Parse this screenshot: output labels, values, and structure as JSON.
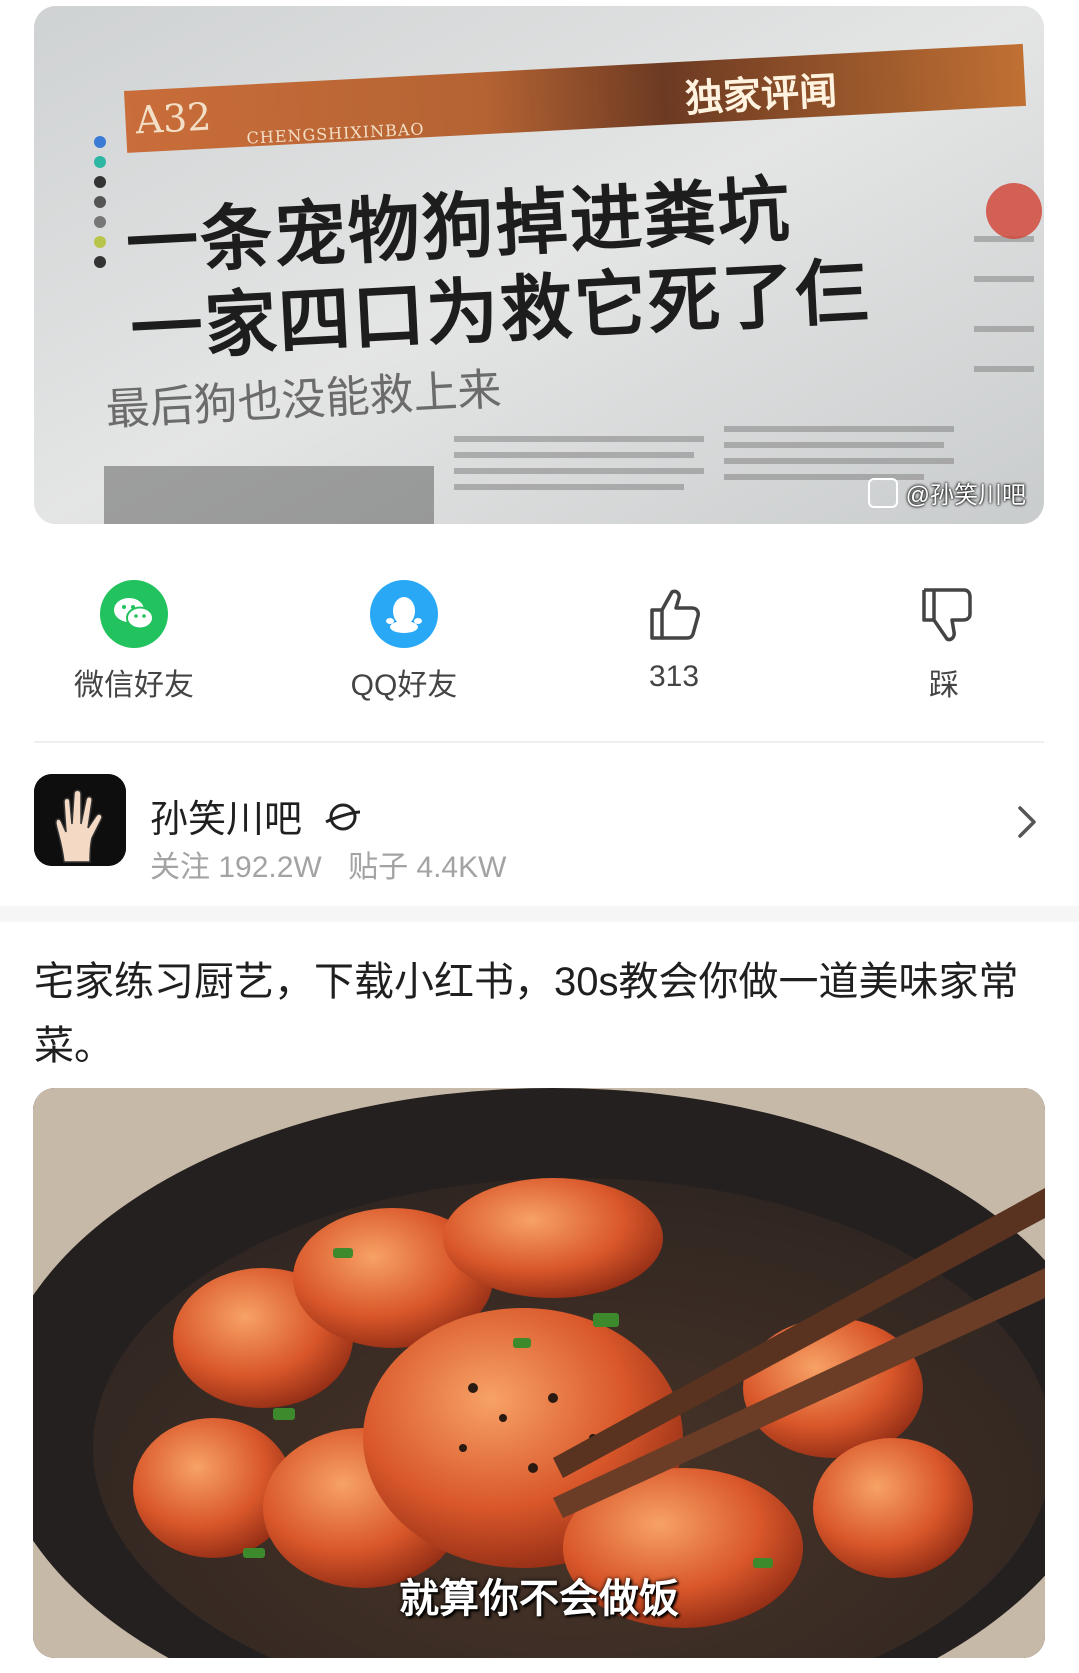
{
  "top_image": {
    "headline_line1": "一条宠物狗掉进粪坑",
    "headline_line2": "一家四口为救它死了仨",
    "subheadline": "最后狗也没能救上来",
    "page_code": "A32",
    "brand_text": "CHENGSHIXINBAO",
    "exclusive_tag": "独家评闻",
    "watermark": "@孙笑川吧"
  },
  "actions": {
    "wechat_label": "微信好友",
    "qq_label": "QQ好友",
    "like_count": "313",
    "dislike_label": "踩"
  },
  "forum": {
    "name": "孙笑川吧",
    "followers": "关注 192.2W",
    "posts": "贴子 4.4KW"
  },
  "post": {
    "text": "宅家练习厨艺，下载小红书，30s教会你做一道美味家常菜。",
    "video_subtitle": "就算你不会做饭"
  },
  "colors": {
    "wechat_green": "#22c35e",
    "qq_blue": "#29a9f5",
    "muted_text": "#a3a3a3"
  }
}
